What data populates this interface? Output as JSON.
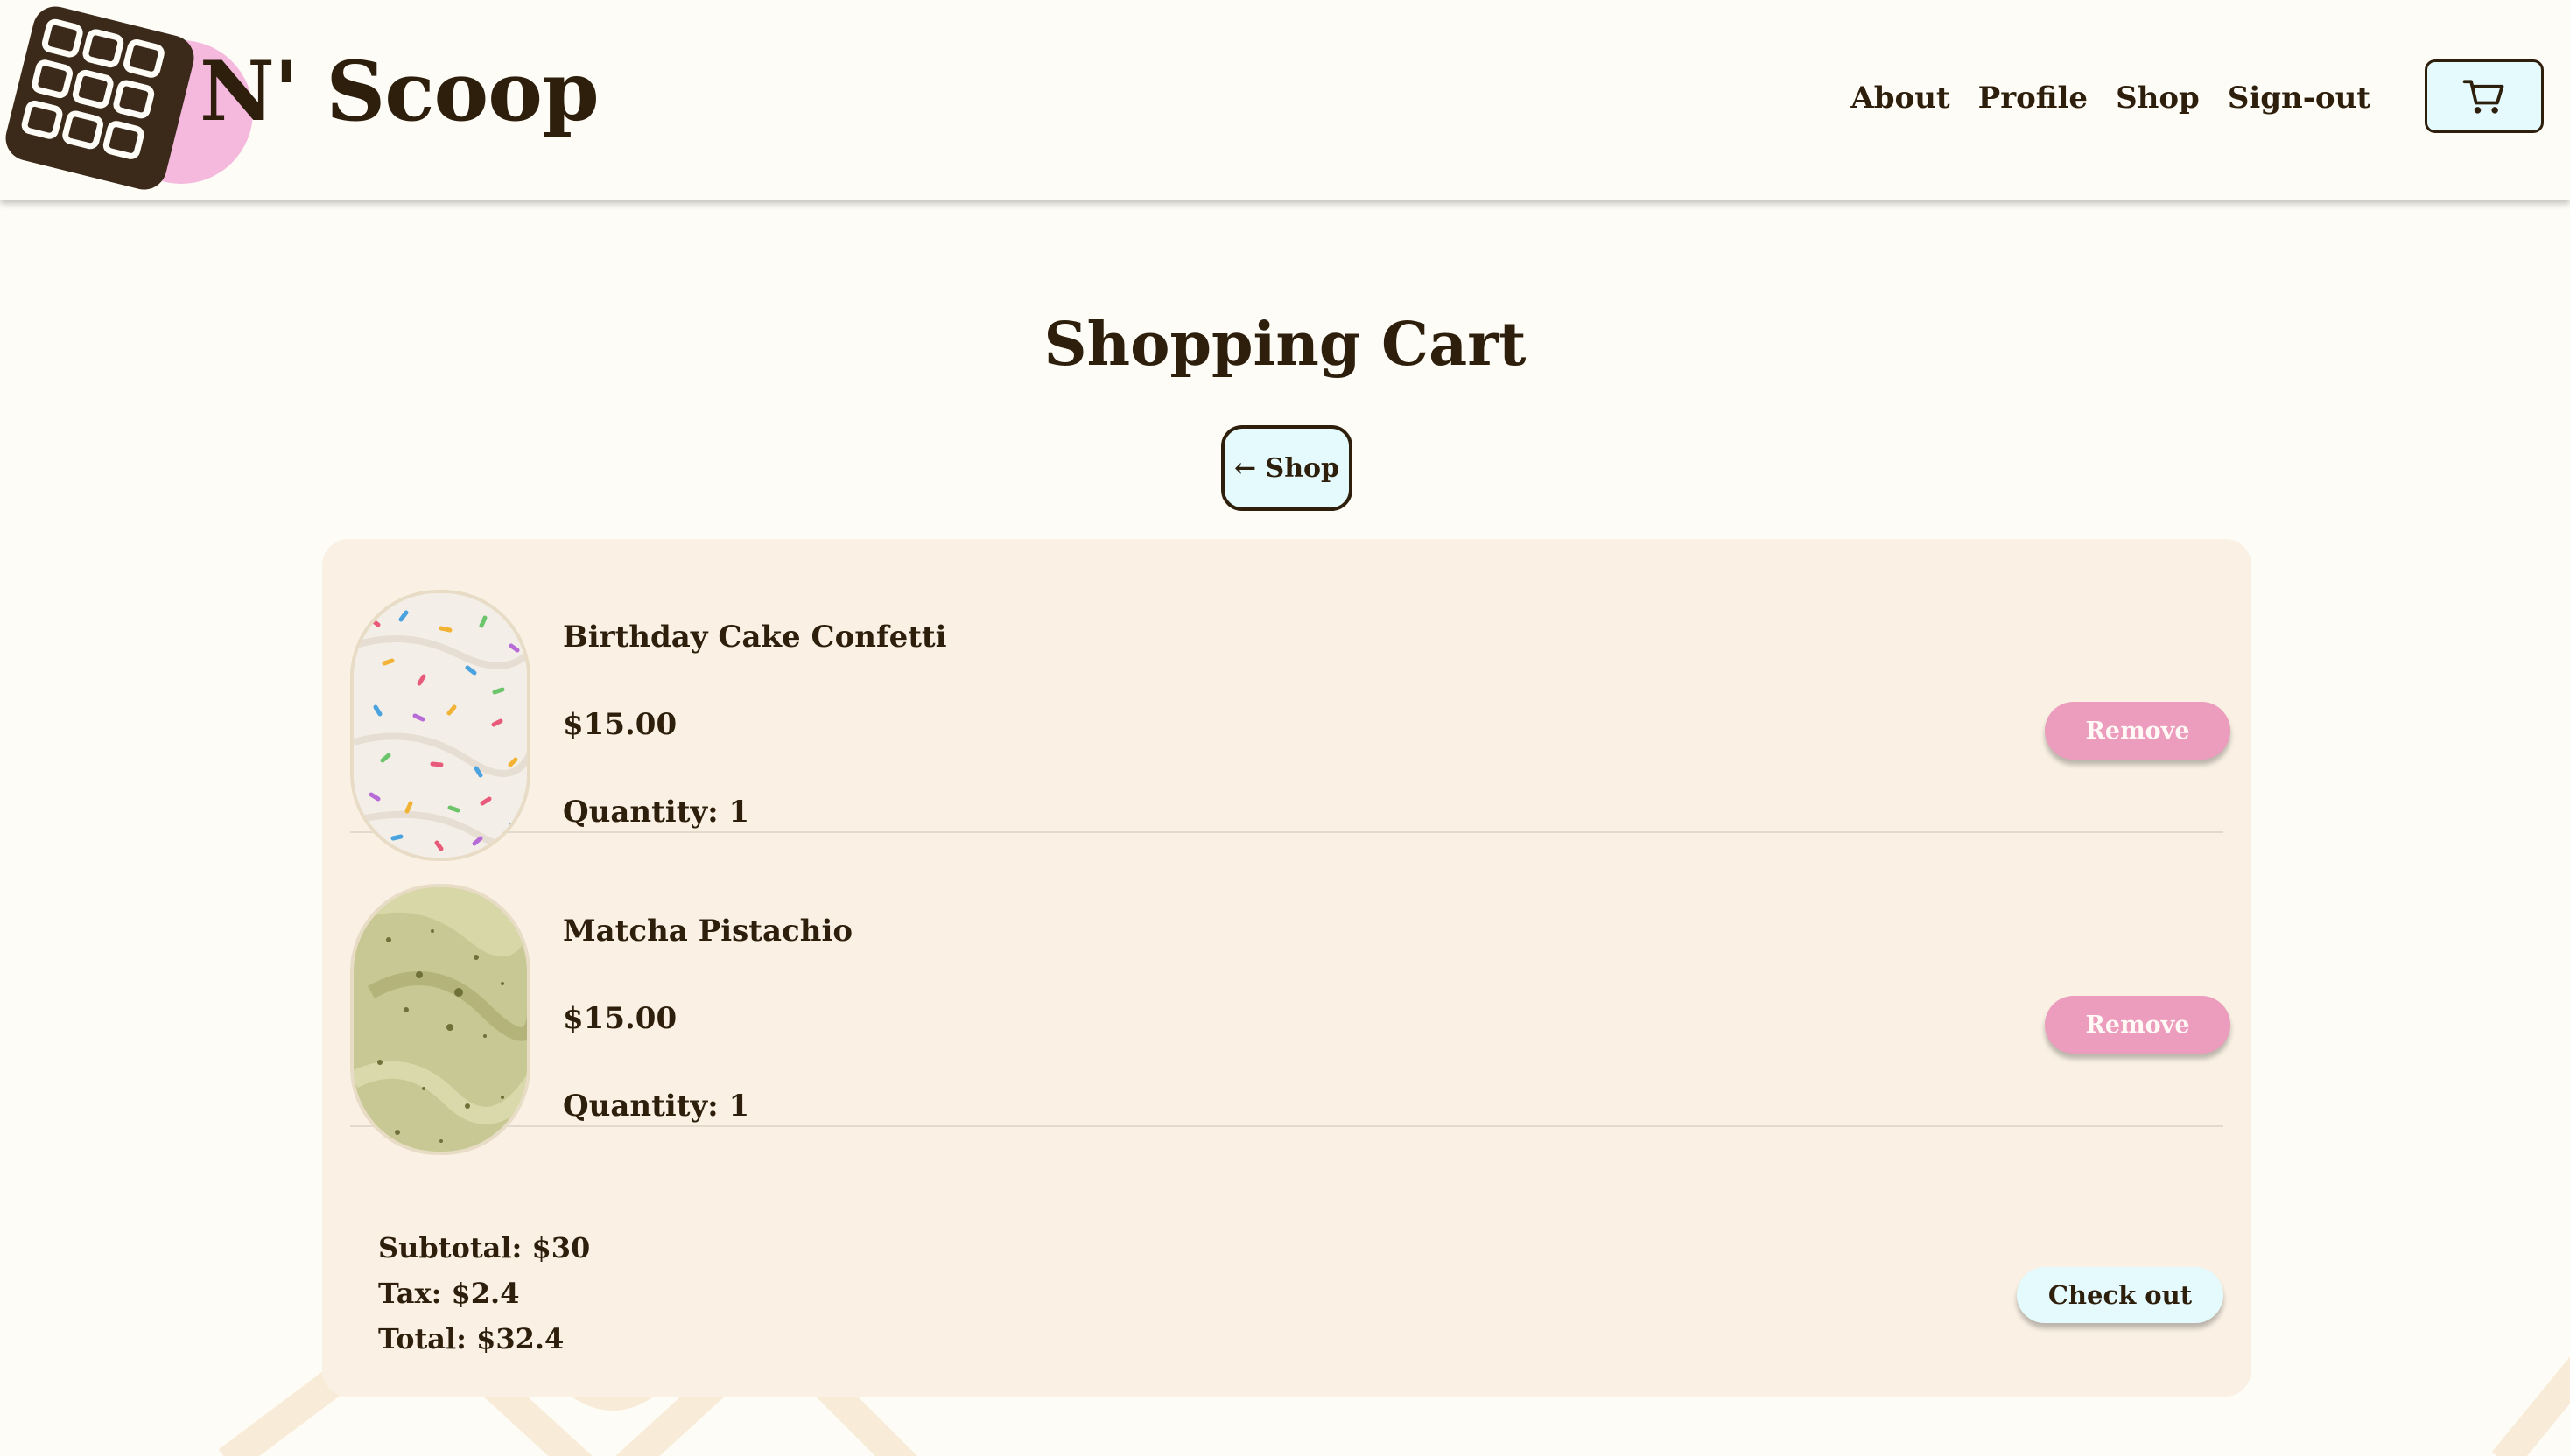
{
  "header": {
    "brand": "N' Scoop",
    "nav": [
      "About",
      "Profile",
      "Shop",
      "Sign-out"
    ]
  },
  "page": {
    "title": "Shopping Cart",
    "back_label": "← Shop"
  },
  "cart": {
    "items": [
      {
        "name": "Birthday Cake Confetti",
        "price": "$15.00",
        "quantity": "Quantity: 1",
        "remove_label": "Remove"
      },
      {
        "name": "Matcha Pistachio",
        "price": "$15.00",
        "quantity": "Quantity: 1",
        "remove_label": "Remove"
      }
    ],
    "subtotal": "Subtotal: $30",
    "tax": "Tax: $2.4",
    "total": "Total: $32.4",
    "checkout_label": "Check out"
  },
  "colors": {
    "background": "#fefcf6",
    "panel": "#faf1e4",
    "text": "#2e1f0c",
    "accent_pink": "#ec9cbc",
    "accent_blue": "#e4fafd"
  },
  "icons": {
    "logo": "waffle-logo-icon",
    "cart": "cart-icon"
  }
}
